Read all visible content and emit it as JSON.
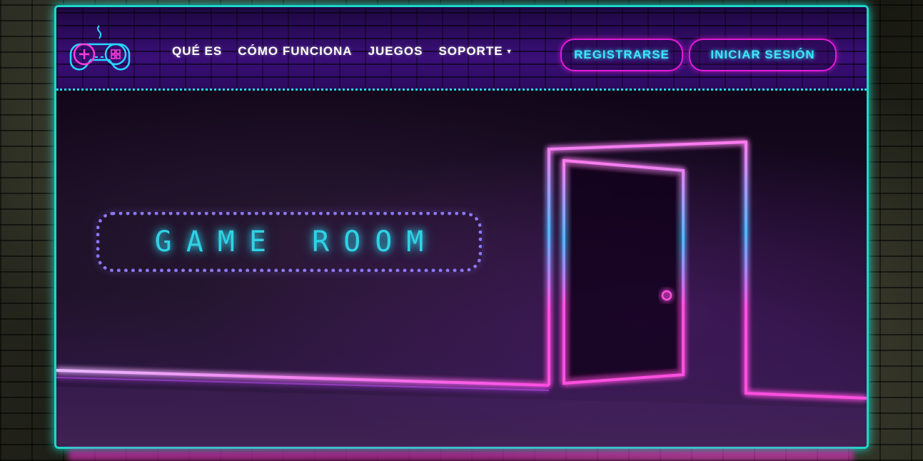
{
  "brand": {
    "logo_icon": "gamepad-icon"
  },
  "nav": {
    "items": [
      {
        "label": "QUÉ ES"
      },
      {
        "label": "CÓMO FUNCIONA"
      },
      {
        "label": "JUEGOS"
      },
      {
        "label": "SOPORTE",
        "has_dropdown": true
      }
    ]
  },
  "auth": {
    "register_label": "REGISTRARSE",
    "login_label": "INICIAR SESIÓN"
  },
  "hero": {
    "title": "GAME ROOM",
    "door_icon": "neon-door-icon"
  },
  "colors": {
    "frame_glow": "#1fd6c9",
    "button_border": "#e21bd8",
    "button_text": "#3de6ff",
    "title_text": "#2fd2e6",
    "title_border": "#8a77f2",
    "neon_pink": "#ff4fe0",
    "neon_blue": "#3aa6ff"
  }
}
